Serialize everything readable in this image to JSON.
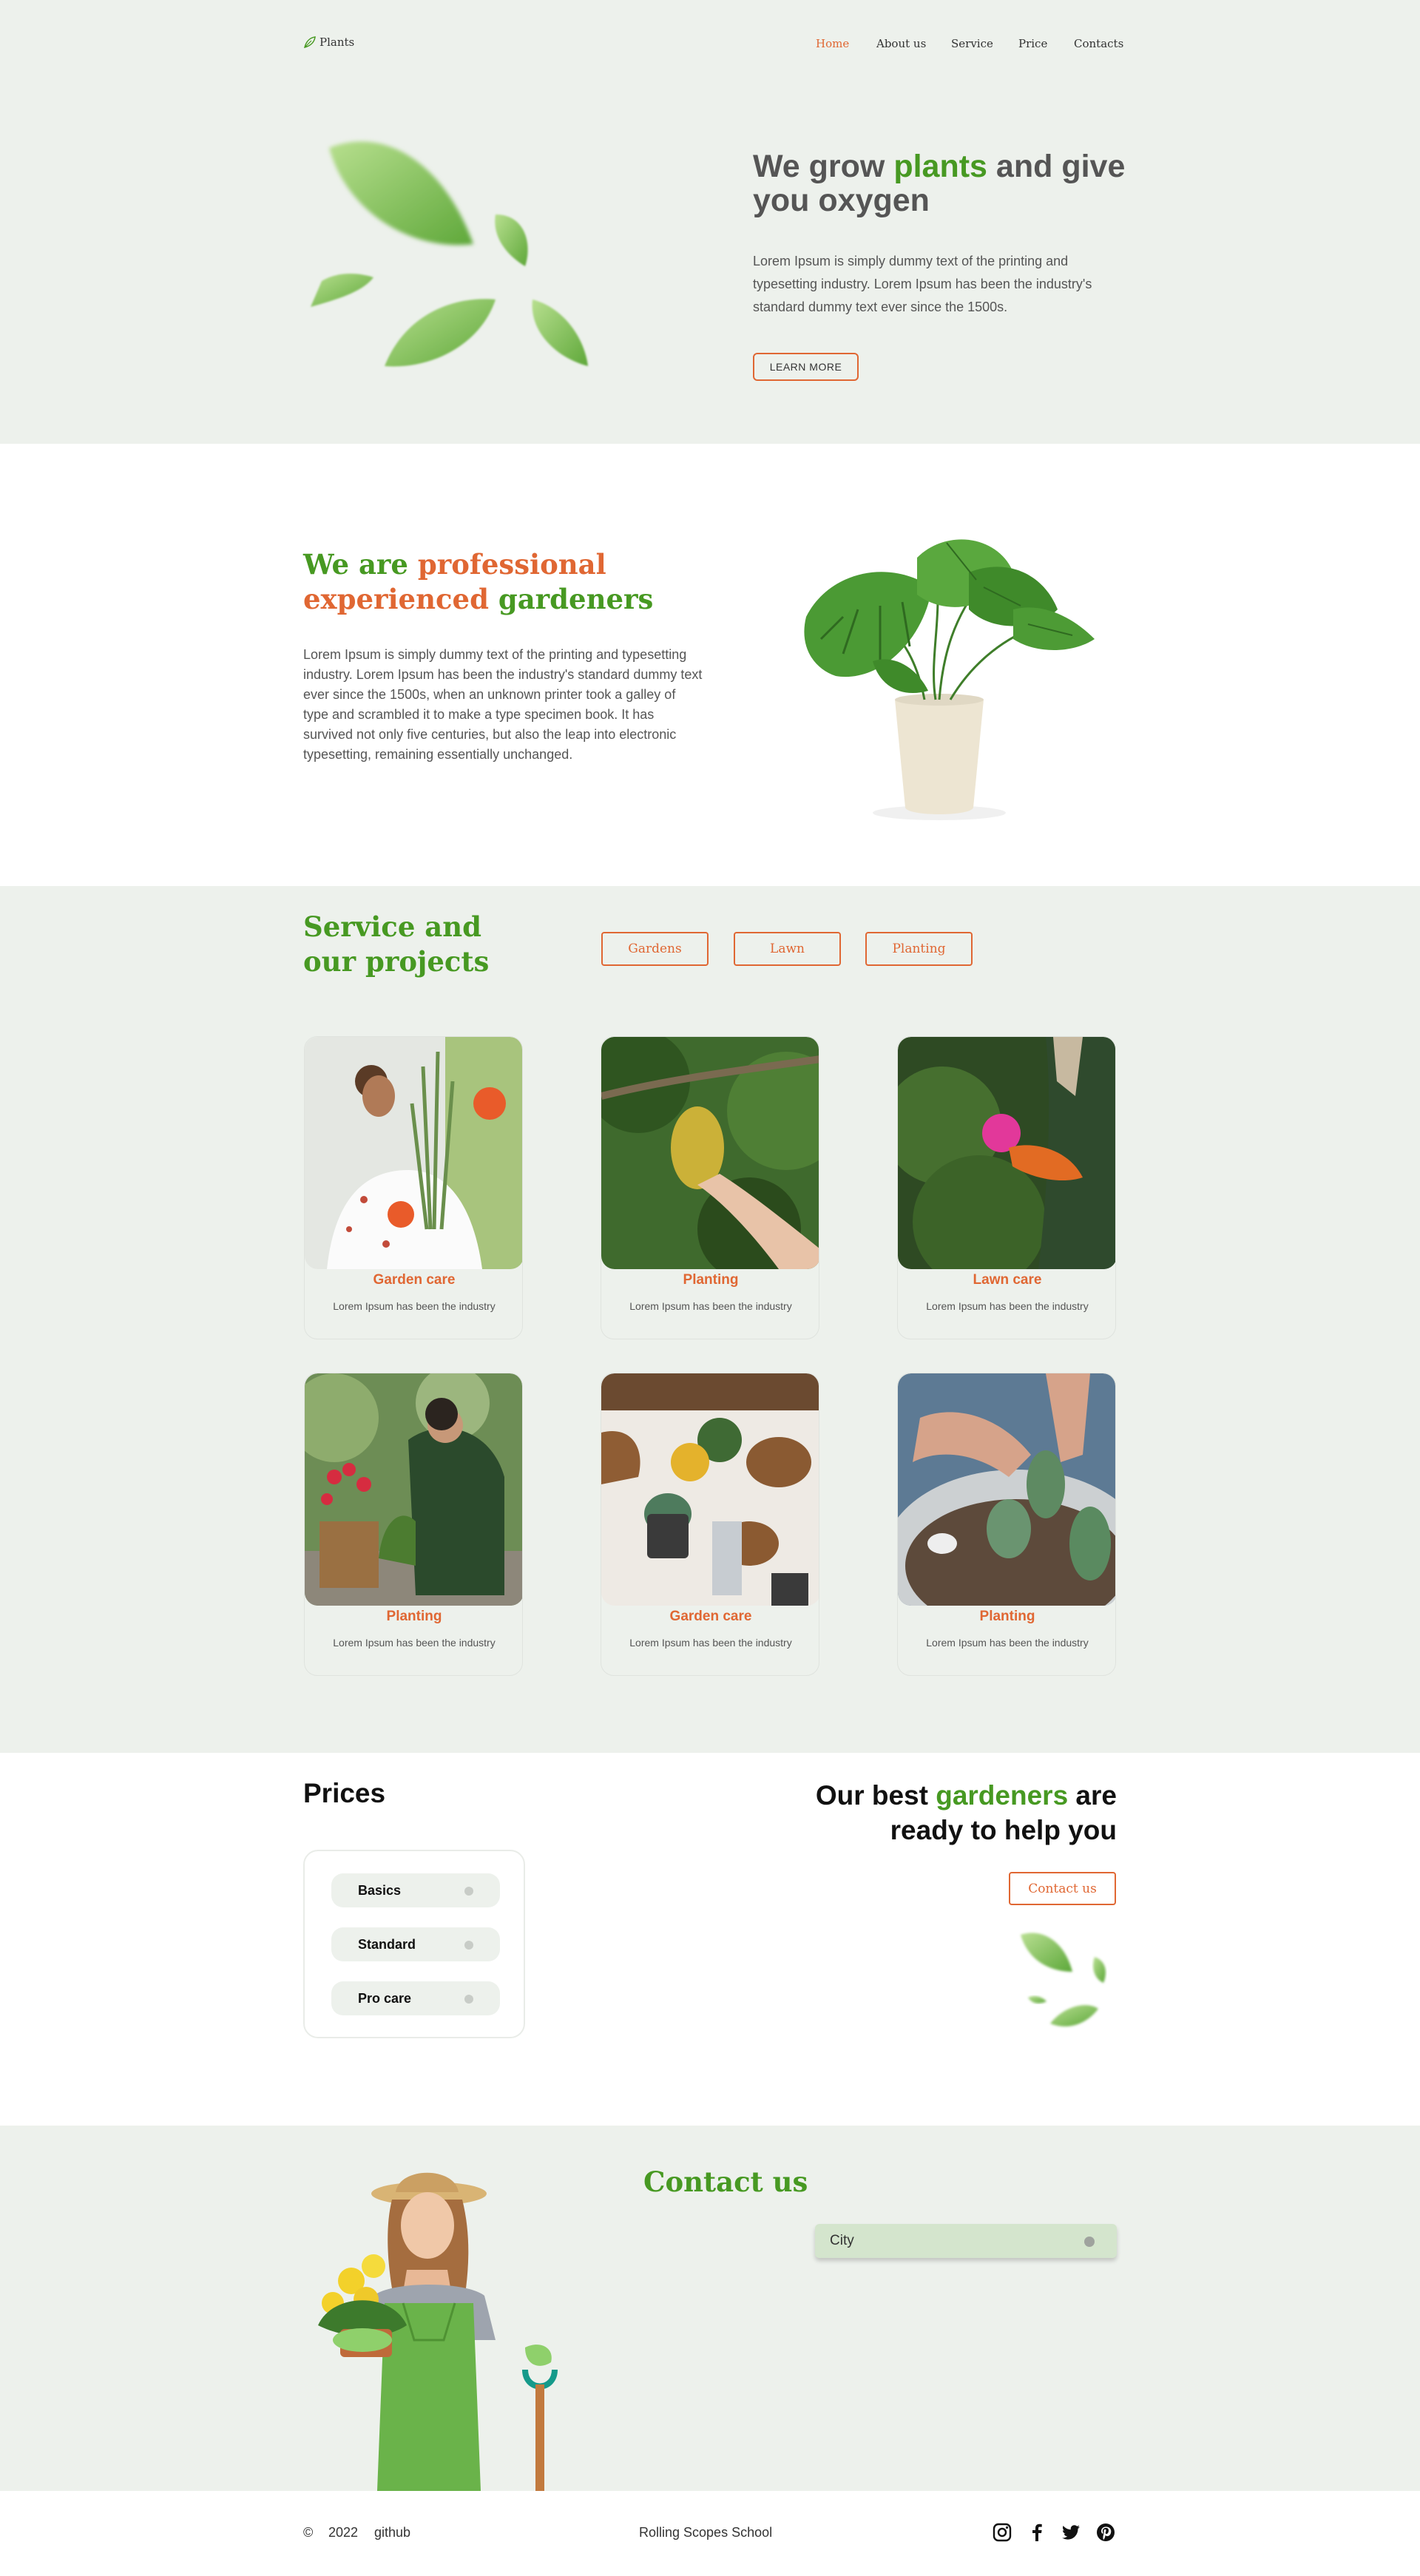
{
  "header": {
    "logo_text": "Plants",
    "nav": [
      "Home",
      "About us",
      "Service",
      "Price",
      "Contacts"
    ]
  },
  "hero": {
    "title_part1": "We grow ",
    "title_highlight": "plants",
    "title_part2": " and give you oxygen",
    "text": "Lorem Ipsum is simply dummy text of the printing and typesetting industry. Lorem Ipsum has been the industry's standard dummy text ever since the 1500s.",
    "button": "LEARN MORE"
  },
  "about": {
    "title_w1": "We are ",
    "title_w2": "professional",
    "title_w3": "experienced",
    "title_w4": " gardeners",
    "text": "Lorem Ipsum is simply dummy text of the printing and typesetting industry. Lorem Ipsum has been the industry's standard dummy text ever since the 1500s, when an unknown printer took a galley of type and scrambled it to make a type specimen book. It has survived not only five centuries, but also the leap into electronic typesetting, remaining essentially unchanged."
  },
  "service": {
    "title": "Service and our projects",
    "filters": [
      "Gardens",
      "Lawn",
      "Planting"
    ],
    "cards": [
      {
        "title": "Garden care",
        "text": "Lorem Ipsum has been the industry"
      },
      {
        "title": "Planting",
        "text": "Lorem Ipsum has been the industry"
      },
      {
        "title": "Lawn care",
        "text": "Lorem Ipsum has been the industry"
      },
      {
        "title": "Planting",
        "text": "Lorem Ipsum has been the industry"
      },
      {
        "title": "Garden care",
        "text": "Lorem Ipsum has been the industry"
      },
      {
        "title": "Planting",
        "text": "Lorem Ipsum has been the industry"
      }
    ]
  },
  "prices": {
    "title": "Prices",
    "items": [
      "Basics",
      "Standard",
      "Pro care"
    ],
    "gardeners_part1": "Our best ",
    "gardeners_highlight": "gardeners",
    "gardeners_part2": " are ready to help you",
    "contact_button": "Contact us"
  },
  "contact": {
    "title": "Contact us",
    "city_label": "City"
  },
  "footer": {
    "copyright": "©",
    "year": "2022",
    "github": "github",
    "school": "Rolling Scopes School",
    "social": [
      "instagram-icon",
      "facebook-icon",
      "twitter-icon",
      "pinterest-icon"
    ]
  },
  "colors": {
    "accent_green": "#479922",
    "accent_orange": "#e06733",
    "background_light": "#edf1ec"
  }
}
